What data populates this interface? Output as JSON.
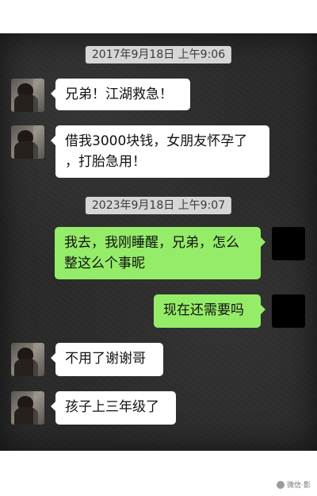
{
  "timestamps": [
    "2017年9月18日 上午9:06",
    "2023年9月18日 上午9:07"
  ],
  "messages": [
    {
      "side": "left",
      "text": "兄弟！江湖救急！"
    },
    {
      "side": "left",
      "line1": "借我3000块钱，女朋友怀孕了",
      "line2": "，打胎急用！"
    },
    {
      "side": "right",
      "line1": "我去，我刚睡醒，兄弟，怎么",
      "line2": "整这么个事昵"
    },
    {
      "side": "right",
      "text": "现在还需要吗"
    },
    {
      "side": "left",
      "text": "不用了谢谢哥"
    },
    {
      "side": "left",
      "text": "孩子上三年级了"
    }
  ],
  "watermark": {
    "text": "微信·影",
    "icon": "platform-logo-icon"
  }
}
